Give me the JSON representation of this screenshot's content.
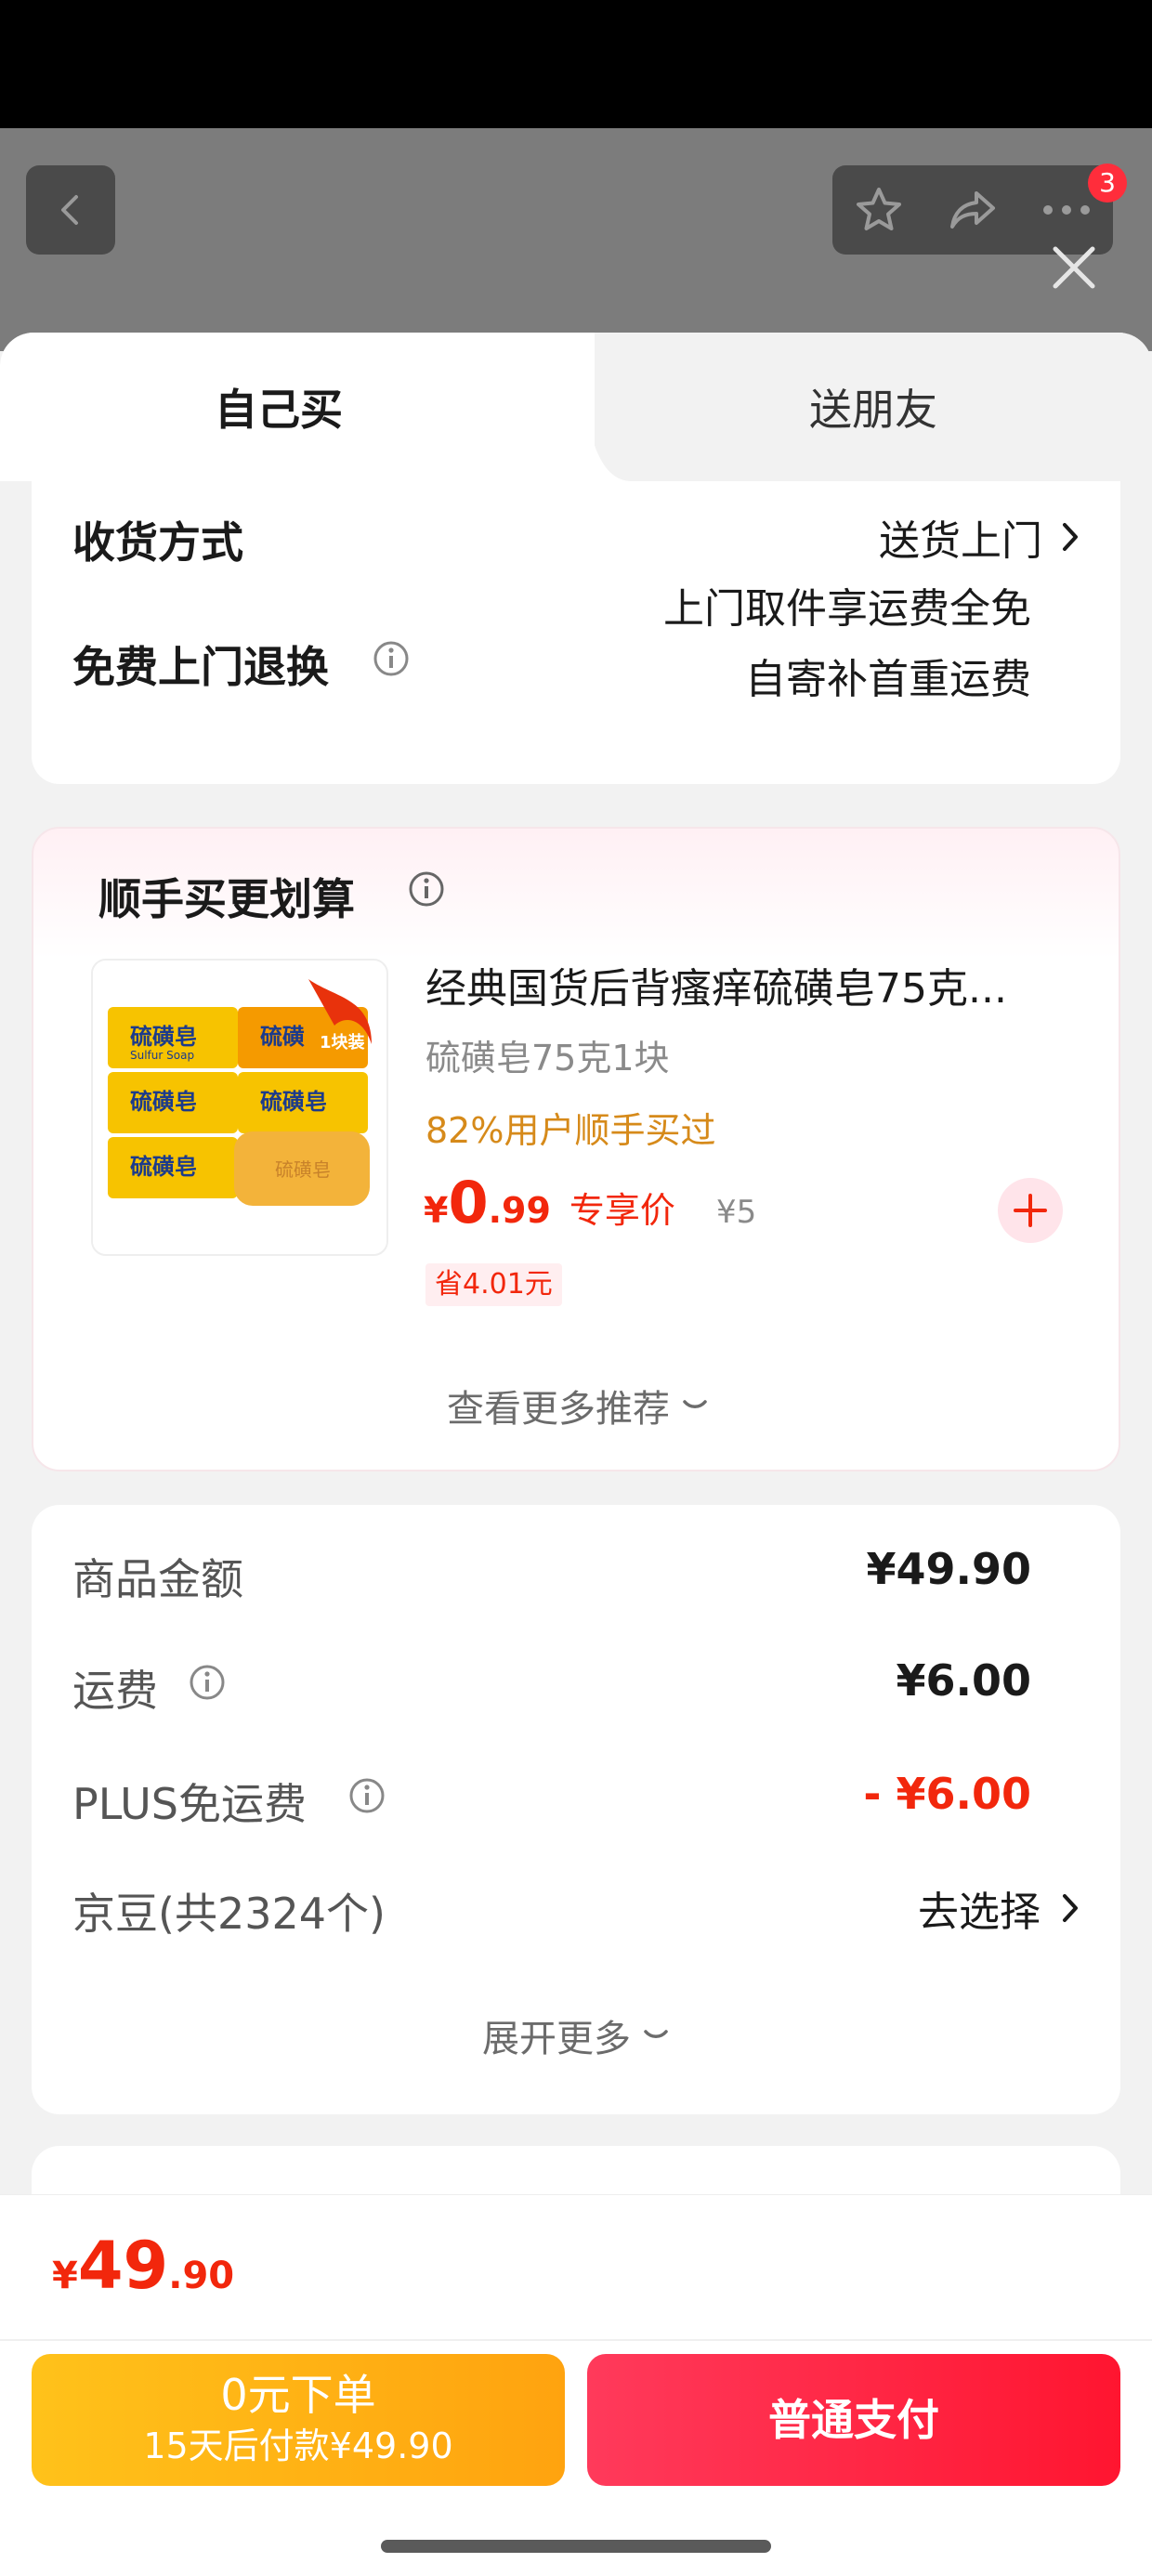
{
  "header": {
    "badge_count": "3"
  },
  "tabs": [
    {
      "label": "自己买"
    },
    {
      "label": "送朋友"
    }
  ],
  "delivery": {
    "method_label": "收货方式",
    "method_value": "送货上门",
    "return_label": "免费上门退换",
    "return_line1": "上门取件享运费全免",
    "return_line2": "自寄补首重运费"
  },
  "recommend": {
    "title": "顺手买更划算",
    "product": {
      "name": "经典国货后背瘙痒硫磺皂75克...",
      "spec": "硫磺皂75克1块",
      "buy_rate": "82%用户顺手买过",
      "currency": "¥",
      "price_int": "0",
      "price_dec": ".99",
      "price_tag": "专享价",
      "orig_price": "¥5",
      "save": "省4.01元",
      "image_text_main": "硫磺皂",
      "image_text_sub": "Sulfur Soap",
      "image_badge": "1块装",
      "image_bar_text": "硫磺皂"
    },
    "more_label": "查看更多推荐"
  },
  "summary": {
    "rows": [
      {
        "label": "商品金额",
        "value": "¥49.90"
      },
      {
        "label": "运费",
        "value": "¥6.00"
      },
      {
        "label": "PLUS免运费",
        "value": "- ¥6.00"
      },
      {
        "label": "京豆(共2324个)",
        "value": "去选择"
      }
    ],
    "expand_label": "展开更多"
  },
  "footer": {
    "currency": "¥",
    "total_int": "49",
    "total_dec": ".90",
    "pay_later_title": "0元下单",
    "pay_later_sub": "15天后付款¥49.90",
    "pay_label": "普通支付"
  },
  "colors": {
    "accent_red": "#f2270c",
    "orange": "#d68a1a",
    "pay_red": "#ff1530",
    "pay_later_yellow": "#ffb516"
  }
}
